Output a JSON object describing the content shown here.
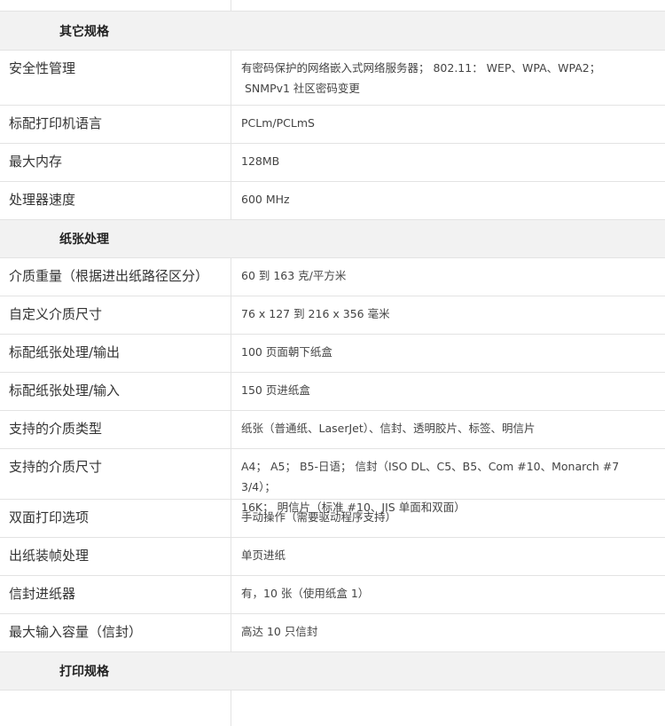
{
  "sections": {
    "other": "其它规格",
    "paper": "纸张处理",
    "print": "打印规格"
  },
  "rows": {
    "security": {
      "label": "安全性管理",
      "value_line1": "有密码保护的网络嵌入式网络服务器； 802.11： WEP、WPA、WPA2；",
      "value_line2": "SNMPv1 社区密码变更"
    },
    "lang": {
      "label": "标配打印机语言",
      "value": "PCLm/PCLmS"
    },
    "memory": {
      "label": "最大内存",
      "value": "128MB"
    },
    "cpu": {
      "label": "处理器速度",
      "value": "600 MHz"
    },
    "weight": {
      "label": "介质重量（根据进出纸路径区分）",
      "value": "60 到 163 克/平方米"
    },
    "custom_size": {
      "label": "自定义介质尺寸",
      "value": "76 x 127 到 216 x 356 毫米"
    },
    "output": {
      "label": "标配纸张处理/输出",
      "value": "100 页面朝下纸盒"
    },
    "input": {
      "label": "标配纸张处理/输入",
      "value": "150 页进纸盒"
    },
    "types": {
      "label": "支持的介质类型",
      "value": "纸张（普通纸、LaserJet）、信封、透明胶片、标签、明信片"
    },
    "sizes": {
      "label": "支持的介质尺寸",
      "value_line1": "A4； A5； B5-日语； 信封（ISO DL、C5、B5、Com #10、Monarch #7 3/4）；",
      "value_line2": "16K； 明信片（标准 #10、JIS 单面和双面）"
    },
    "duplex": {
      "label": "双面打印选项",
      "value": "手动操作（需要驱动程序支持）"
    },
    "finishing": {
      "label": "出纸装帧处理",
      "value": "单页进纸"
    },
    "envelope_feeder": {
      "label": "信封进纸器",
      "value": "有，10 张（使用纸盒 1）"
    },
    "envelope_capacity": {
      "label": "最大输入容量（信封）",
      "value": "高达 10 只信封"
    }
  }
}
